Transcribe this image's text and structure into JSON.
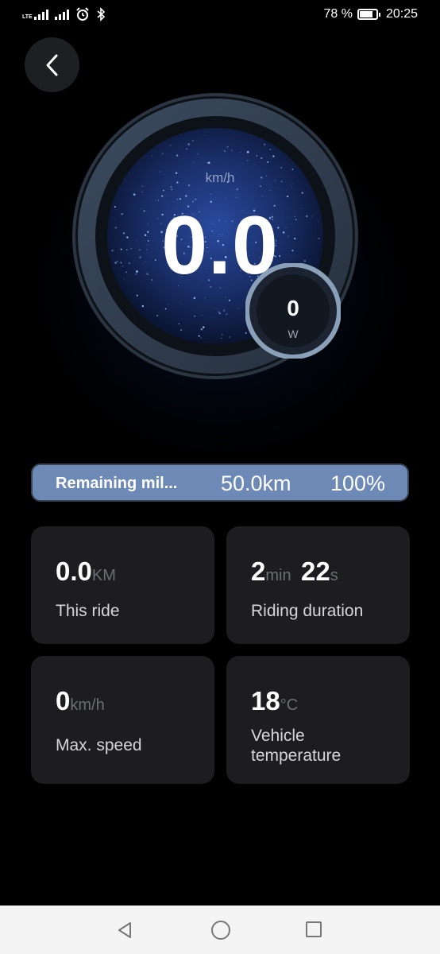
{
  "status_bar": {
    "network_label": "LTE",
    "battery_text": "78 %",
    "battery_level": 0.78,
    "time": "20:25",
    "icons": [
      "signal-lte-icon",
      "signal-icon",
      "alarm-icon",
      "bluetooth-icon",
      "battery-icon"
    ]
  },
  "header": {
    "back_icon": "chevron-left-icon"
  },
  "speedometer": {
    "unit": "km/h",
    "speed": "0.0",
    "power_value": "0",
    "power_unit": "W"
  },
  "remaining": {
    "label": "Remaining mil...",
    "distance": "50.0km",
    "percent": "100%",
    "level": 1.0,
    "color": "#6d8ab7"
  },
  "stats": {
    "this_ride": {
      "value": "0.0",
      "unit": "KM",
      "label": "This ride"
    },
    "duration": {
      "minutes": "2",
      "min_unit": "min",
      "seconds": "22",
      "sec_unit": "s",
      "label": "Riding duration"
    },
    "max_speed": {
      "value": "0",
      "unit": "km/h",
      "label": "Max. speed"
    },
    "temperature": {
      "value": "18",
      "unit": "°C",
      "label": "Vehicle temperature"
    }
  },
  "nav_bar": {
    "icons": [
      "back-triangle-icon",
      "home-circle-icon",
      "recents-square-icon"
    ]
  }
}
